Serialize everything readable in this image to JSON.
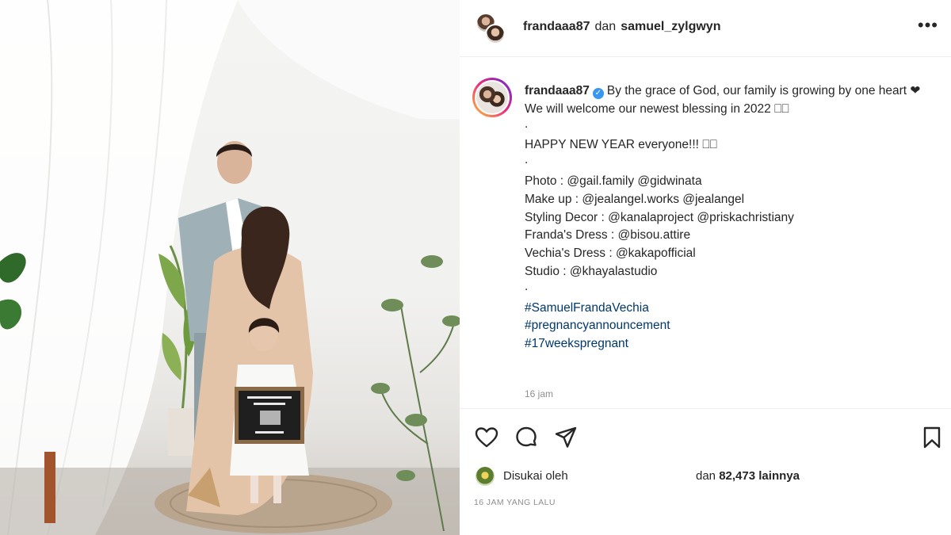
{
  "header": {
    "user1": "frandaaa87",
    "joiner": "dan",
    "user2": "samuel_zylgwyn",
    "more_icon": "more-horizontal-icon"
  },
  "caption": {
    "username": "frandaaa87",
    "verified_icon": "verified-badge-icon",
    "line1": "By the grace of God, our family is growing by one heart ❤",
    "line2": "We will welcome our newest blessing in 2022 ⎕⎕",
    "dot": ".",
    "line3": "HAPPY NEW YEAR everyone!!! ⎕⎕",
    "credits": [
      "Photo : @gail.family @gidwinata",
      "Make up : @jealangel.works @jealangel",
      "Styling Decor : @kanalaproject @priskachristiany",
      "Franda's Dress : @bisou.attire",
      "Vechia's Dress : @kakapofficial",
      "Studio : @khayalastudio"
    ],
    "hashtags": [
      "#SamuelFrandaVechia",
      "#pregnancyannouncement",
      "#17weekspregnant"
    ],
    "time": "16 jam"
  },
  "actions": {
    "like_icon": "heart-icon",
    "comment_icon": "comment-icon",
    "share_icon": "share-icon",
    "save_icon": "bookmark-icon"
  },
  "likes": {
    "prefix": "Disukai oleh",
    "middle": "dan",
    "count": "82,473",
    "suffix": "lainnya"
  },
  "timestamp": "16 JAM YANG LALU",
  "colors": {
    "link": "#00376b",
    "verified": "#3897f0",
    "muted": "#8e8e8e"
  }
}
